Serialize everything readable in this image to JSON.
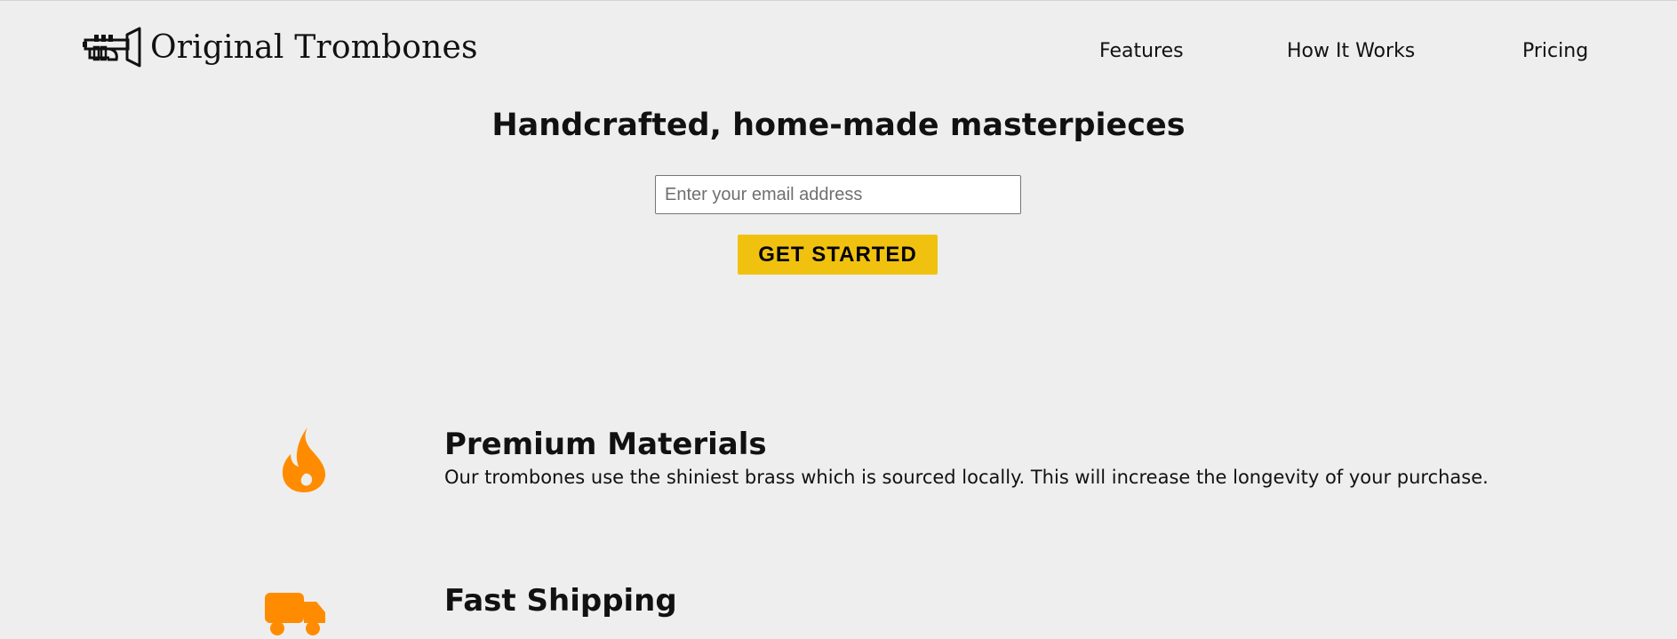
{
  "brand": {
    "name": "Original Trombones",
    "logo_icon": "trumpet-icon"
  },
  "nav": {
    "items": [
      {
        "label": "Features"
      },
      {
        "label": "How It Works"
      },
      {
        "label": "Pricing"
      }
    ]
  },
  "hero": {
    "title": "Handcrafted, home-made masterpieces",
    "email_placeholder": "Enter your email address",
    "email_value": "",
    "cta_label": "GET STARTED"
  },
  "features": [
    {
      "icon": "flame-icon",
      "title": "Premium Materials",
      "description": "Our trombones use the shiniest brass which is sourced locally. This will increase the longevity of your purchase."
    },
    {
      "icon": "truck-icon",
      "title": "Fast Shipping",
      "description": ""
    }
  ],
  "colors": {
    "background": "#eeeeee",
    "accent_button": "#f0c20f",
    "icon_orange": "#ff8c00",
    "text": "#111111"
  }
}
